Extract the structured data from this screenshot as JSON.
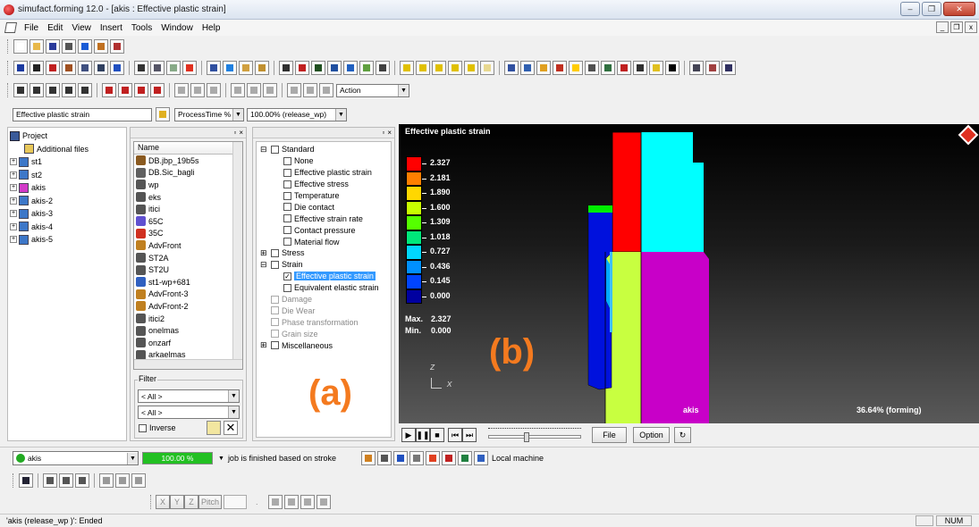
{
  "window": {
    "title": "simufact.forming 12.0 - [akis : Effective plastic strain]",
    "controls": [
      "–",
      "❐",
      "✕"
    ],
    "mdi_controls": [
      "_",
      "❐",
      "x"
    ]
  },
  "menu": [
    "File",
    "Edit",
    "View",
    "Insert",
    "Tools",
    "Window",
    "Help"
  ],
  "toolbar3": {
    "action_select": "Action"
  },
  "toolbar4": {
    "result_select": "Effective plastic strain",
    "time_select": "ProcessTime %",
    "step_select": "100.00% (release_wp)"
  },
  "project_tree": {
    "root": "Project",
    "items": [
      {
        "label": "Additional files",
        "expandable": false
      },
      {
        "label": "st1",
        "expandable": true
      },
      {
        "label": "st2",
        "expandable": true
      },
      {
        "label": "akis",
        "expandable": true
      },
      {
        "label": "akis-2",
        "expandable": true
      },
      {
        "label": "akis-3",
        "expandable": true
      },
      {
        "label": "akis-4",
        "expandable": true
      },
      {
        "label": "akis-5",
        "expandable": true
      }
    ]
  },
  "name_list": {
    "header": "Name",
    "items": [
      "DB.jbp_19b5s",
      "DB.Sic_bagli",
      "wp",
      "eks",
      "itici",
      "65C",
      "35C",
      "AdvFront",
      "ST2A",
      "ST2U",
      "st1-wp+681",
      "AdvFront-3",
      "AdvFront-2",
      "itici2",
      "onelmas",
      "onzarf",
      "arkaelmas"
    ],
    "filter_label": "Filter",
    "filter1": "< All >",
    "filter2": "< All >",
    "inverse_label": "Inverse"
  },
  "results_tree": {
    "items": [
      {
        "label": "Standard",
        "level": 0,
        "expander": "⊟",
        "checked": false,
        "gray": false
      },
      {
        "label": "None",
        "level": 1,
        "checked": false,
        "gray": false
      },
      {
        "label": "Effective plastic strain",
        "level": 1,
        "checked": false,
        "gray": false
      },
      {
        "label": "Effective stress",
        "level": 1,
        "checked": false,
        "gray": false
      },
      {
        "label": "Temperature",
        "level": 1,
        "checked": false,
        "gray": false
      },
      {
        "label": "Die contact",
        "level": 1,
        "checked": false,
        "gray": false
      },
      {
        "label": "Effective strain rate",
        "level": 1,
        "checked": false,
        "gray": false
      },
      {
        "label": "Contact pressure",
        "level": 1,
        "checked": false,
        "gray": false
      },
      {
        "label": "Material flow",
        "level": 1,
        "checked": false,
        "gray": false
      },
      {
        "label": "Stress",
        "level": 0,
        "expander": "⊞",
        "checked": false,
        "gray": false
      },
      {
        "label": "Strain",
        "level": 0,
        "expander": "⊟",
        "checked": false,
        "gray": false
      },
      {
        "label": "Effective plastic strain",
        "level": 1,
        "checked": true,
        "selected": true,
        "gray": false
      },
      {
        "label": "Equivalent elastic strain",
        "level": 1,
        "checked": false,
        "gray": false
      },
      {
        "label": "Damage",
        "level": 0,
        "checked": false,
        "gray": true
      },
      {
        "label": "Die Wear",
        "level": 0,
        "checked": false,
        "gray": true
      },
      {
        "label": "Phase transformation",
        "level": 0,
        "checked": false,
        "gray": true
      },
      {
        "label": "Grain size",
        "level": 0,
        "checked": false,
        "gray": true
      },
      {
        "label": "Miscellaneous",
        "level": 0,
        "expander": "⊞",
        "checked": false,
        "gray": false
      }
    ]
  },
  "viewport": {
    "title": "Effective plastic strain",
    "legend": [
      {
        "value": "2.327",
        "color": "#ff0000"
      },
      {
        "value": "2.181",
        "color": "#ff7f00"
      },
      {
        "value": "1.890",
        "color": "#ffd700"
      },
      {
        "value": "1.600",
        "color": "#c8ff00"
      },
      {
        "value": "1.309",
        "color": "#55ff00"
      },
      {
        "value": "1.018",
        "color": "#00e87a"
      },
      {
        "value": "0.727",
        "color": "#00d7ff"
      },
      {
        "value": "0.436",
        "color": "#0090ff"
      },
      {
        "value": "0.145",
        "color": "#0044ff"
      },
      {
        "value": "0.000",
        "color": "#0000a0"
      }
    ],
    "max_label": "Max.",
    "max_value": "2.327",
    "min_label": "Min.",
    "min_value": "0.000",
    "axis_z": "z",
    "axis_x": "x",
    "object_label": "akis",
    "progress_label": "36.64% (forming)",
    "colors": {
      "cyan": "#00ffff",
      "red": "#ff0000",
      "magenta": "#cc00cc",
      "lime": "#c8ff40",
      "blue": "#0011dd"
    }
  },
  "annotations": {
    "a": "(a)",
    "b": "(b)"
  },
  "playback": {
    "file_button": "File",
    "option_button": "Option"
  },
  "jobbar": {
    "job_select": "akis",
    "progress_text": "100.00 %",
    "progress": 1.0,
    "job_status": "job is finished based on stroke",
    "machine": "Local machine"
  },
  "coord_bar": {
    "x": "X",
    "y": "Y",
    "z": "Z",
    "pitch": "Pitch"
  },
  "statusbar": {
    "message": "'akis (release_wp )': Ended",
    "num": "NUM"
  }
}
